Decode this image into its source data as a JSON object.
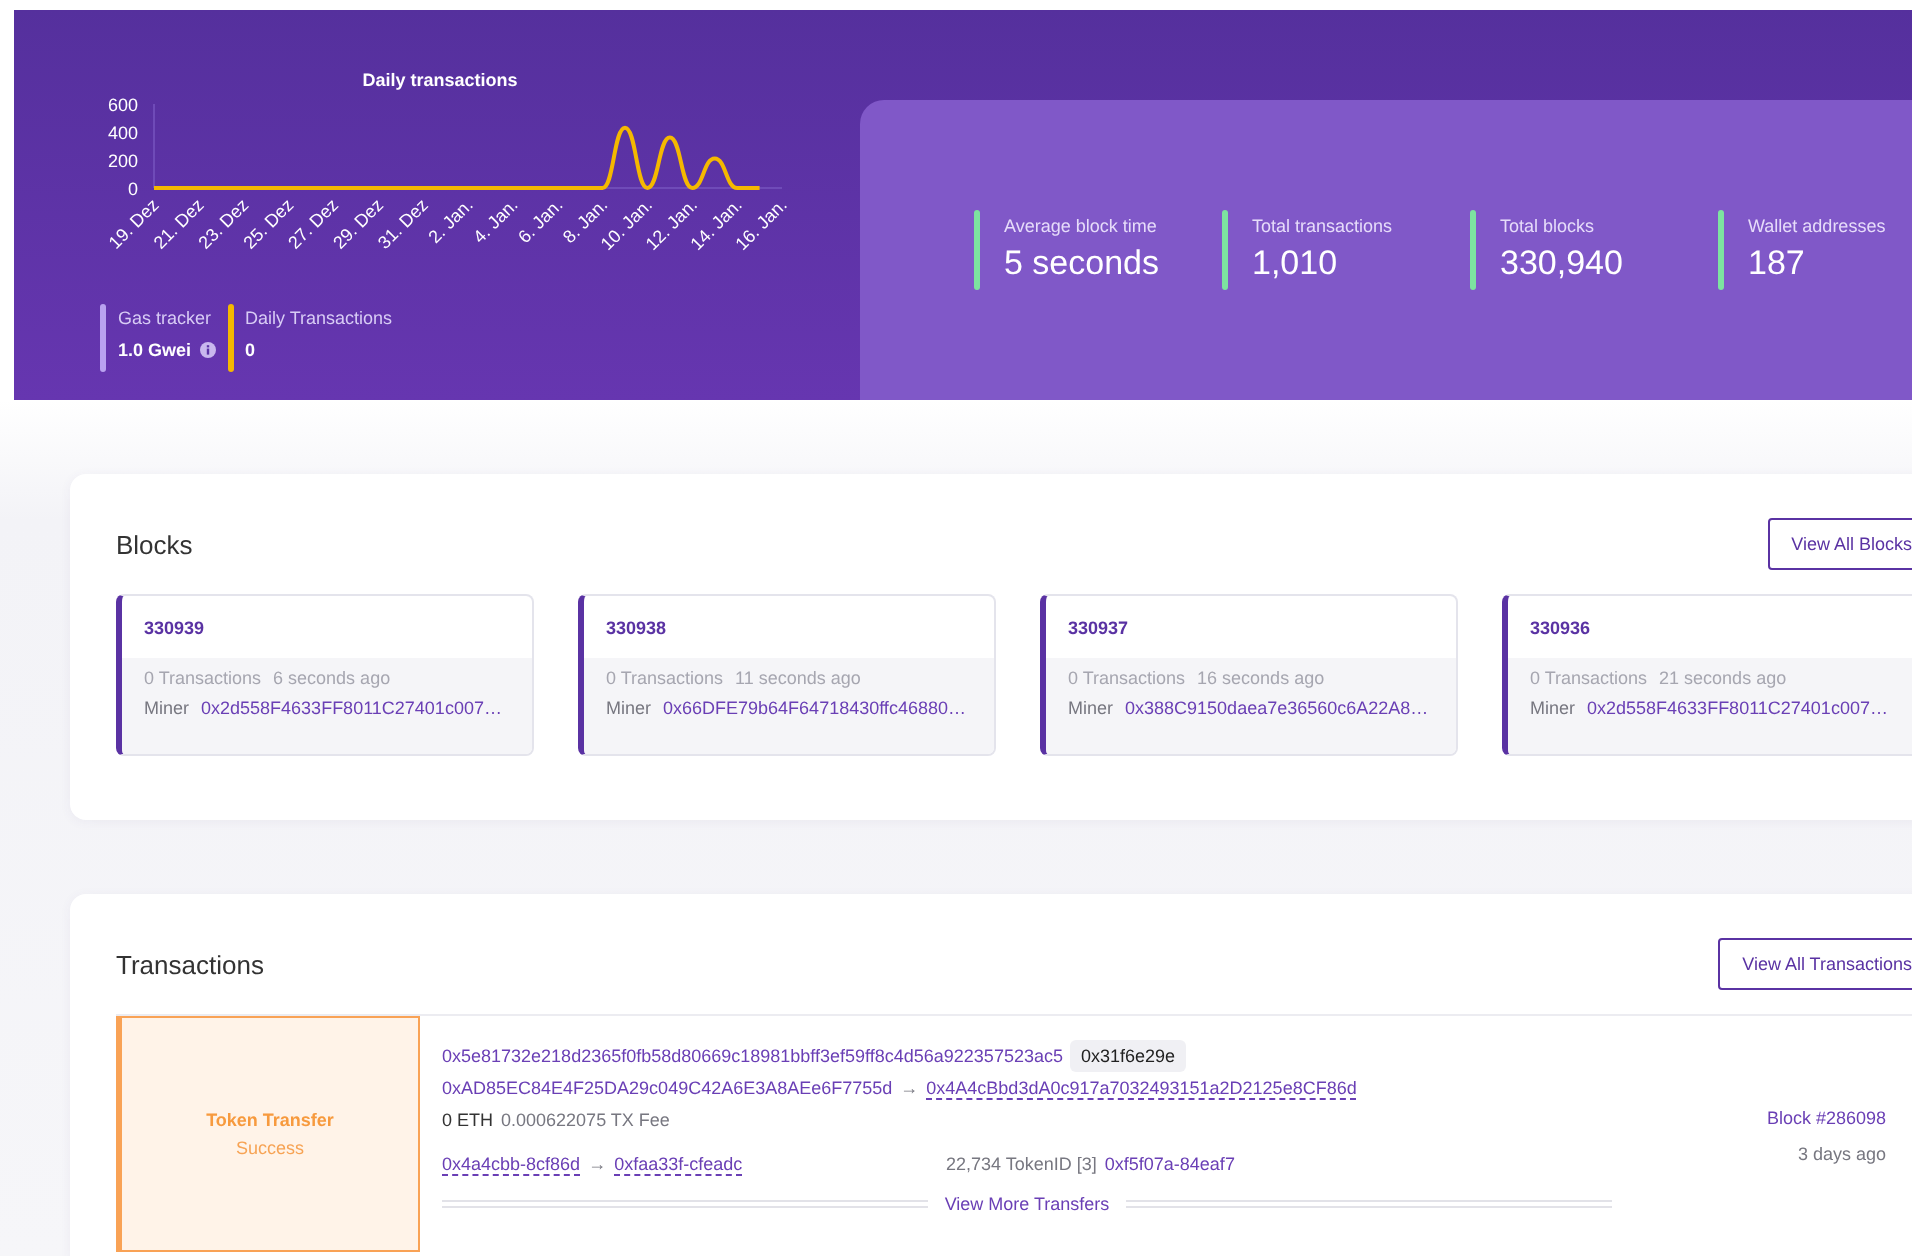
{
  "chart": {
    "chart_data": {
      "type": "line",
      "title": "Daily transactions",
      "categories": [
        "19. Dez",
        null,
        "21. Dez",
        null,
        "23. Dez",
        null,
        "25. Dez",
        null,
        "27. Dez",
        null,
        "29. Dez",
        null,
        "31. Dez",
        null,
        "2. Jan.",
        null,
        "4. Jan.",
        null,
        "6. Jan.",
        null,
        "8. Jan.",
        null,
        "10. Jan.",
        null,
        "12. Jan.",
        null,
        "14. Jan.",
        null,
        "16. Jan."
      ],
      "series": [
        {
          "color": "#f5b800",
          "values": [
            0,
            0,
            0,
            0,
            0,
            0,
            0,
            0,
            0,
            0,
            0,
            0,
            0,
            0,
            0,
            0,
            0,
            0,
            0,
            0,
            0,
            430,
            0,
            360,
            0,
            210,
            0,
            0,
            null
          ]
        }
      ],
      "ylim": [
        0,
        600
      ],
      "yticks": [
        0,
        200,
        400,
        600
      ]
    }
  },
  "legend": [
    {
      "label": "Gas tracker",
      "value": "1.0 Gwei",
      "info": true,
      "color": "#b9a2f0"
    },
    {
      "label": "Daily Transactions",
      "value": "0",
      "info": false,
      "color": "#f5b800"
    }
  ],
  "stats": [
    {
      "label": "Average block time",
      "value": "5 seconds"
    },
    {
      "label": "Total transactions",
      "value": "1,010"
    },
    {
      "label": "Total blocks",
      "value": "330,940"
    },
    {
      "label": "Wallet addresses",
      "value": "187"
    }
  ],
  "blocks": {
    "title": "Blocks",
    "button": "View All Blocks",
    "items": [
      {
        "number": "330939",
        "transactions": "0 Transactions",
        "age": "6 seconds ago",
        "miner_label": "Miner",
        "miner": "0x2d558F4633FF8011C27401c007…"
      },
      {
        "number": "330938",
        "transactions": "0 Transactions",
        "age": "11 seconds ago",
        "miner_label": "Miner",
        "miner": "0x66DFE79b64F64718430ffc46880…"
      },
      {
        "number": "330937",
        "transactions": "0 Transactions",
        "age": "16 seconds ago",
        "miner_label": "Miner",
        "miner": "0x388C9150daea7e36560c6A22A8…"
      },
      {
        "number": "330936",
        "transactions": "0 Transactions",
        "age": "21 seconds ago",
        "miner_label": "Miner",
        "miner": "0x2d558F4633FF8011C27401c007…"
      }
    ]
  },
  "transactions": {
    "title": "Transactions",
    "button": "View All Transactions",
    "rows": [
      {
        "type": "Token Transfer",
        "status": "Success",
        "hash": "0x5e81732e218d2365f0fb58d80669c18981bbff3ef59ff8c4d56a922357523ac5",
        "method": "0x31f6e29e",
        "from": "0xAD85EC84E4F25DA29c049C42A6E3A8AEe6F7755d",
        "arrow": "→",
        "to": "0x4A4cBbd3dA0c917a7032493151a2D2125e8CF86d",
        "value": "0 ETH",
        "fee": "0.000622075 TX Fee",
        "transfer_from": "0x4a4cbb-8cf86d",
        "transfer_arrow": "→",
        "transfer_to": "0xfaa33f-cfeadc",
        "amount": "22,734 TokenID [3]",
        "token": "0xf5f07a-84eaf7",
        "more": "View More Transfers",
        "block": "Block #286098",
        "age": "3 days ago"
      }
    ]
  }
}
